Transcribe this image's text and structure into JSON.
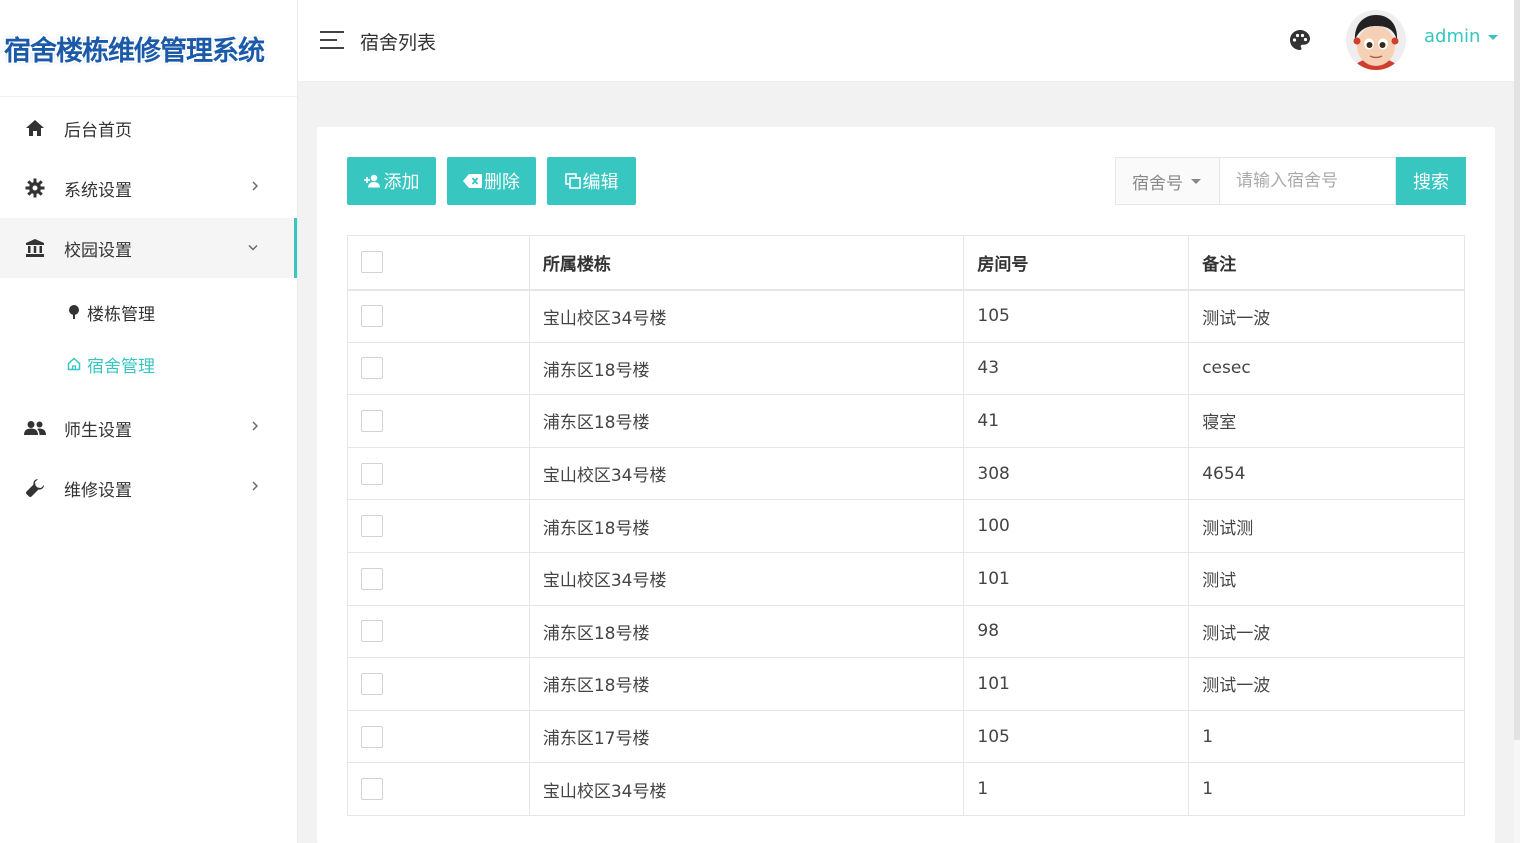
{
  "app": {
    "logo_text": "宿舍楼栋维修管理系统"
  },
  "sidebar": {
    "items": [
      {
        "label": "后台首页",
        "icon": "home-icon"
      },
      {
        "label": "系统设置",
        "icon": "gear-icon"
      },
      {
        "label": "校园设置",
        "icon": "bank-icon"
      },
      {
        "label": "师生设置",
        "icon": "users-icon"
      },
      {
        "label": "维修设置",
        "icon": "wrench-icon"
      }
    ],
    "submenu": [
      {
        "label": "楼栋管理",
        "icon": "pin-icon"
      },
      {
        "label": "宿舍管理",
        "icon": "house-icon"
      }
    ]
  },
  "header": {
    "title": "宿舍列表",
    "username": "admin"
  },
  "toolbar": {
    "add_label": "添加",
    "delete_label": "删除",
    "edit_label": "编辑",
    "select_value": "宿舍号",
    "search_placeholder": "请输入宿舍号",
    "search_label": "搜索"
  },
  "table": {
    "headers": [
      "所属楼栋",
      "房间号",
      "备注"
    ],
    "rows": [
      [
        "宝山校区34号楼",
        "105",
        "测试一波"
      ],
      [
        "浦东区18号楼",
        "43",
        "cesec"
      ],
      [
        "浦东区18号楼",
        "41",
        "寝室"
      ],
      [
        "宝山校区34号楼",
        "308",
        "4654"
      ],
      [
        "浦东区18号楼",
        "100",
        "测试测"
      ],
      [
        "宝山校区34号楼",
        "101",
        "测试"
      ],
      [
        "浦东区18号楼",
        "98",
        "测试一波"
      ],
      [
        "浦东区18号楼",
        "101",
        "测试一波"
      ],
      [
        "浦东区17号楼",
        "105",
        "1"
      ],
      [
        "宝山校区34号楼",
        "1",
        "1"
      ]
    ]
  },
  "colors": {
    "accent": "#37c6c0",
    "logo": "#1b5aa8"
  }
}
